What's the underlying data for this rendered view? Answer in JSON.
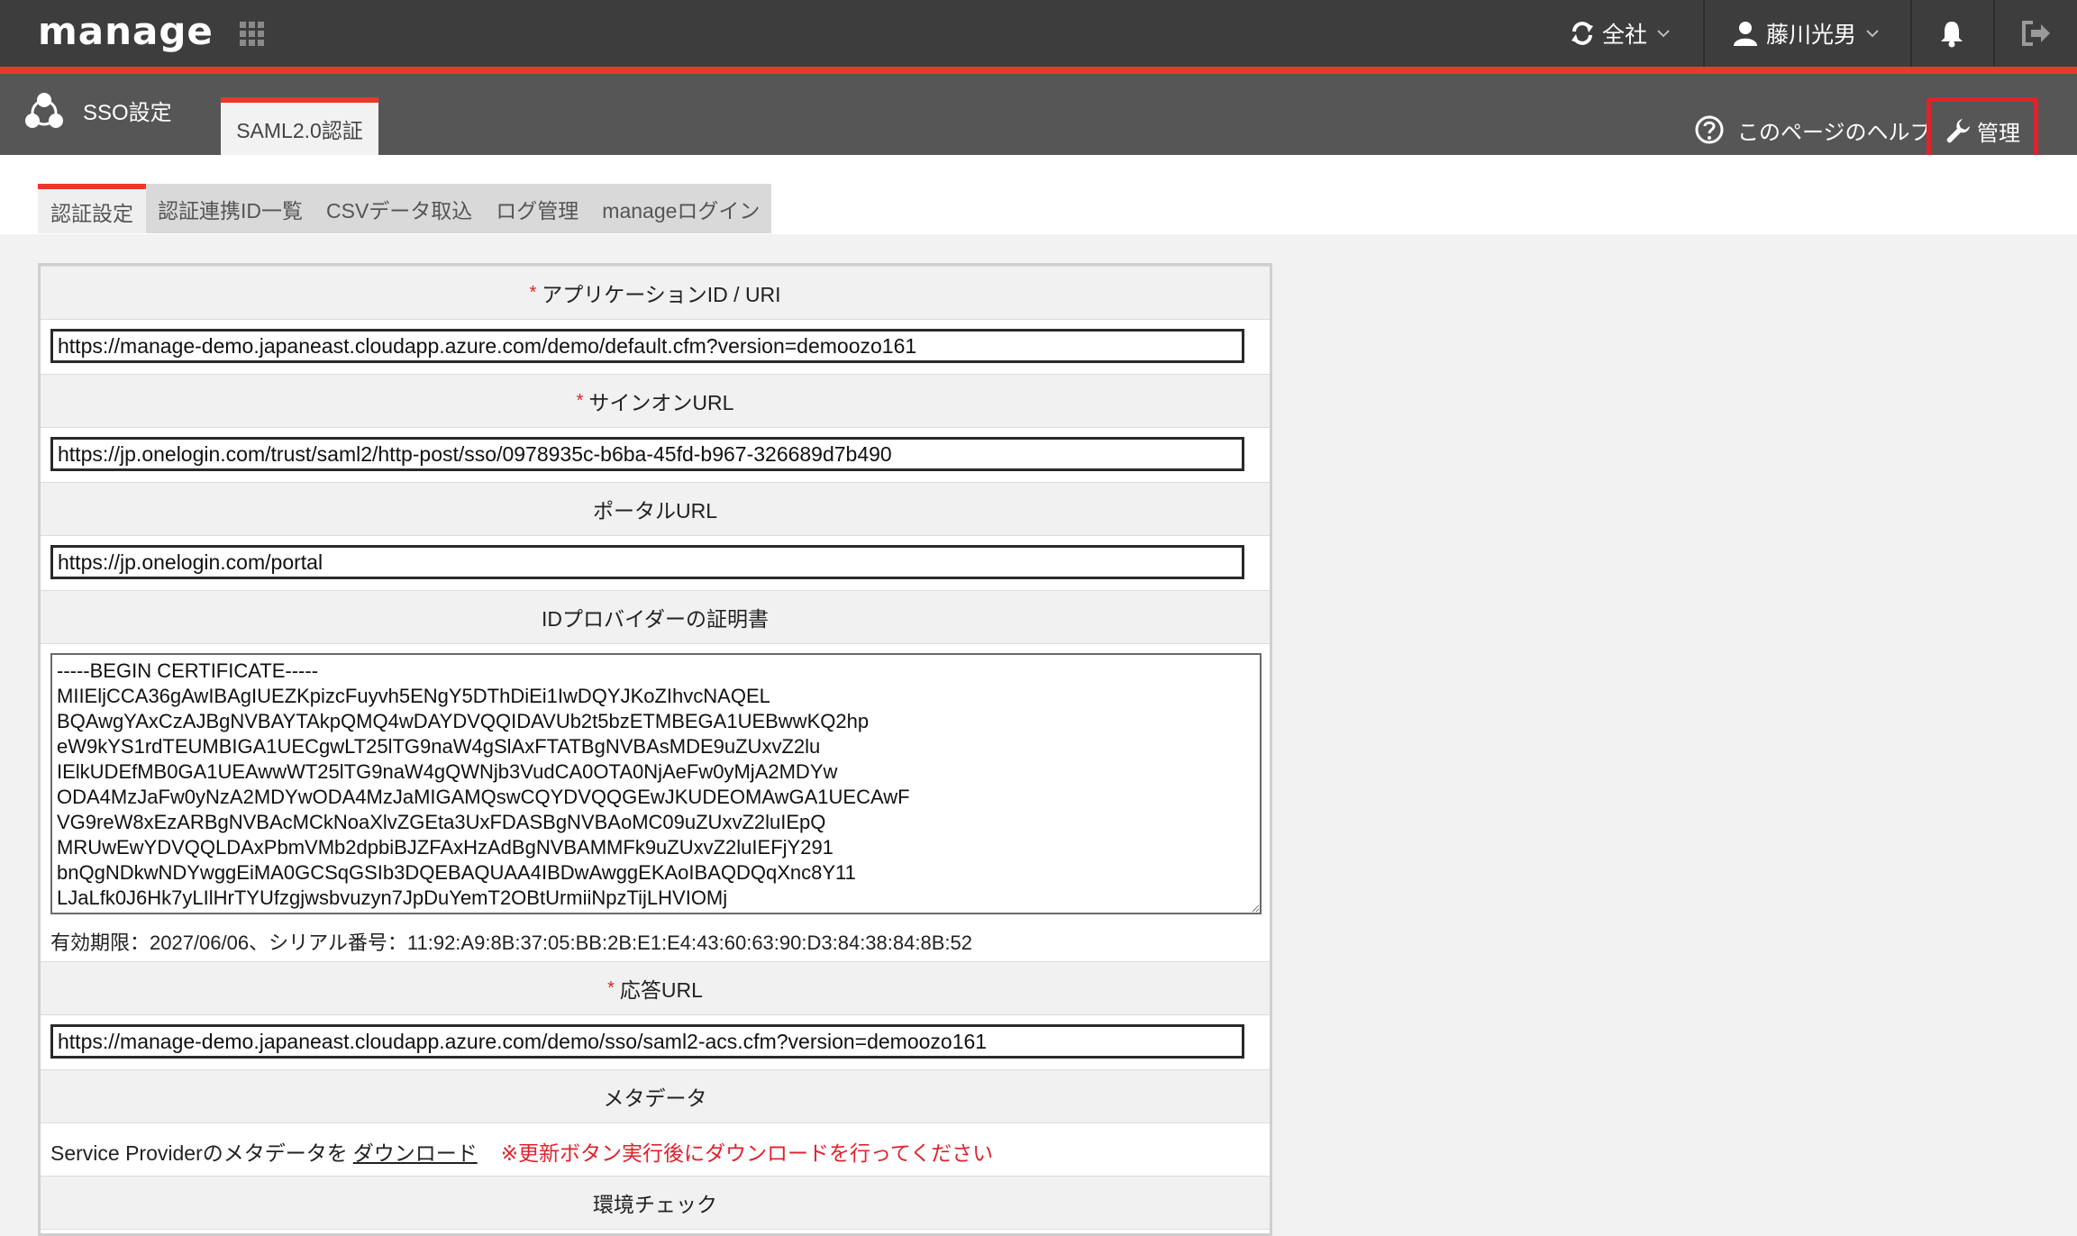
{
  "topbar": {
    "logo": "manage",
    "company": "全社",
    "user": "藤川光男"
  },
  "subheader": {
    "title": "SSO設定",
    "tab": "SAML2.0認証",
    "help": "このページのヘルプ",
    "admin": "管理"
  },
  "tabs": [
    {
      "label": "認証設定",
      "active": true
    },
    {
      "label": "認証連携ID一覧",
      "active": false
    },
    {
      "label": "CSVデータ取込",
      "active": false
    },
    {
      "label": "ログ管理",
      "active": false
    },
    {
      "label": "manageログイン",
      "active": false
    }
  ],
  "form": {
    "app_id": {
      "label": "アプリケーションID / URI",
      "value": "https://manage-demo.japaneast.cloudapp.azure.com/demo/default.cfm?version=demoozo161"
    },
    "signon": {
      "label": "サインオンURL",
      "value": "https://jp.onelogin.com/trust/saml2/http-post/sso/0978935c-b6ba-45fd-b967-326689d7b490"
    },
    "portal": {
      "label": "ポータルURL",
      "value": "https://jp.onelogin.com/portal"
    },
    "cert": {
      "label": "IDプロバイダーの証明書",
      "value": "-----BEGIN CERTIFICATE-----\nMIIEljCCA36gAwIBAgIUEZKpizcFuyvh5ENgY5DThDiEi1IwDQYJKoZIhvcNAQEL\nBQAwgYAxCzAJBgNVBAYTAkpQMQ4wDAYDVQQIDAVUb2t5bzETMBEGA1UEBwwKQ2hp\neW9kYS1rdTEUMBIGA1UECgwLT25lTG9naW4gSlAxFTATBgNVBAsMDE9uZUxvZ2lu\nIElkUDEfMB0GA1UEAwwWT25lTG9naW4gQWNjb3VudCA0OTA0NjAeFw0yMjA2MDYw\nODA4MzJaFw0yNzA2MDYwODA4MzJaMIGAMQswCQYDVQQGEwJKUDEOMAwGA1UECAwF\nVG9reW8xEzARBgNVBAcMCkNoaXlvZGEta3UxFDASBgNVBAoMC09uZUxvZ2luIEpQ\nMRUwEwYDVQQLDAxPbmVMb2dpbiBJZFAxHzAdBgNVBAMMFk9uZUxvZ2luIEFjY291\nbnQgNDkwNDYwggEiMA0GCSqGSIb3DQEBAQUAA4IBDwAwggEKAoIBAQDQqXnc8Y11\nLJaLfk0J6Hk7yLIlHrTYUfzgjwsbvuzyn7JpDuYemT2OBtUrmiiNpzTijLHVIOMj",
      "info": "有効期限：2027/06/06、シリアル番号：11:92:A9:8B:37:05:BB:2B:E1:E4:43:60:63:90:D3:84:38:84:8B:52"
    },
    "acs": {
      "label": "応答URL",
      "value": "https://manage-demo.japaneast.cloudapp.azure.com/demo/sso/saml2-acs.cfm?version=demoozo161"
    },
    "metadata": {
      "label": "メタデータ",
      "prefix": "Service Providerのメタデータを",
      "link": "ダウンロード",
      "warning": "※更新ボタン実行後にダウンロードを行ってください"
    },
    "env_check": {
      "label": "環境チェック"
    }
  },
  "colors": {
    "accent": "#e8392a",
    "topbar": "#3d3d3d",
    "subheader": "#565656",
    "highlight": "#e0222c"
  }
}
